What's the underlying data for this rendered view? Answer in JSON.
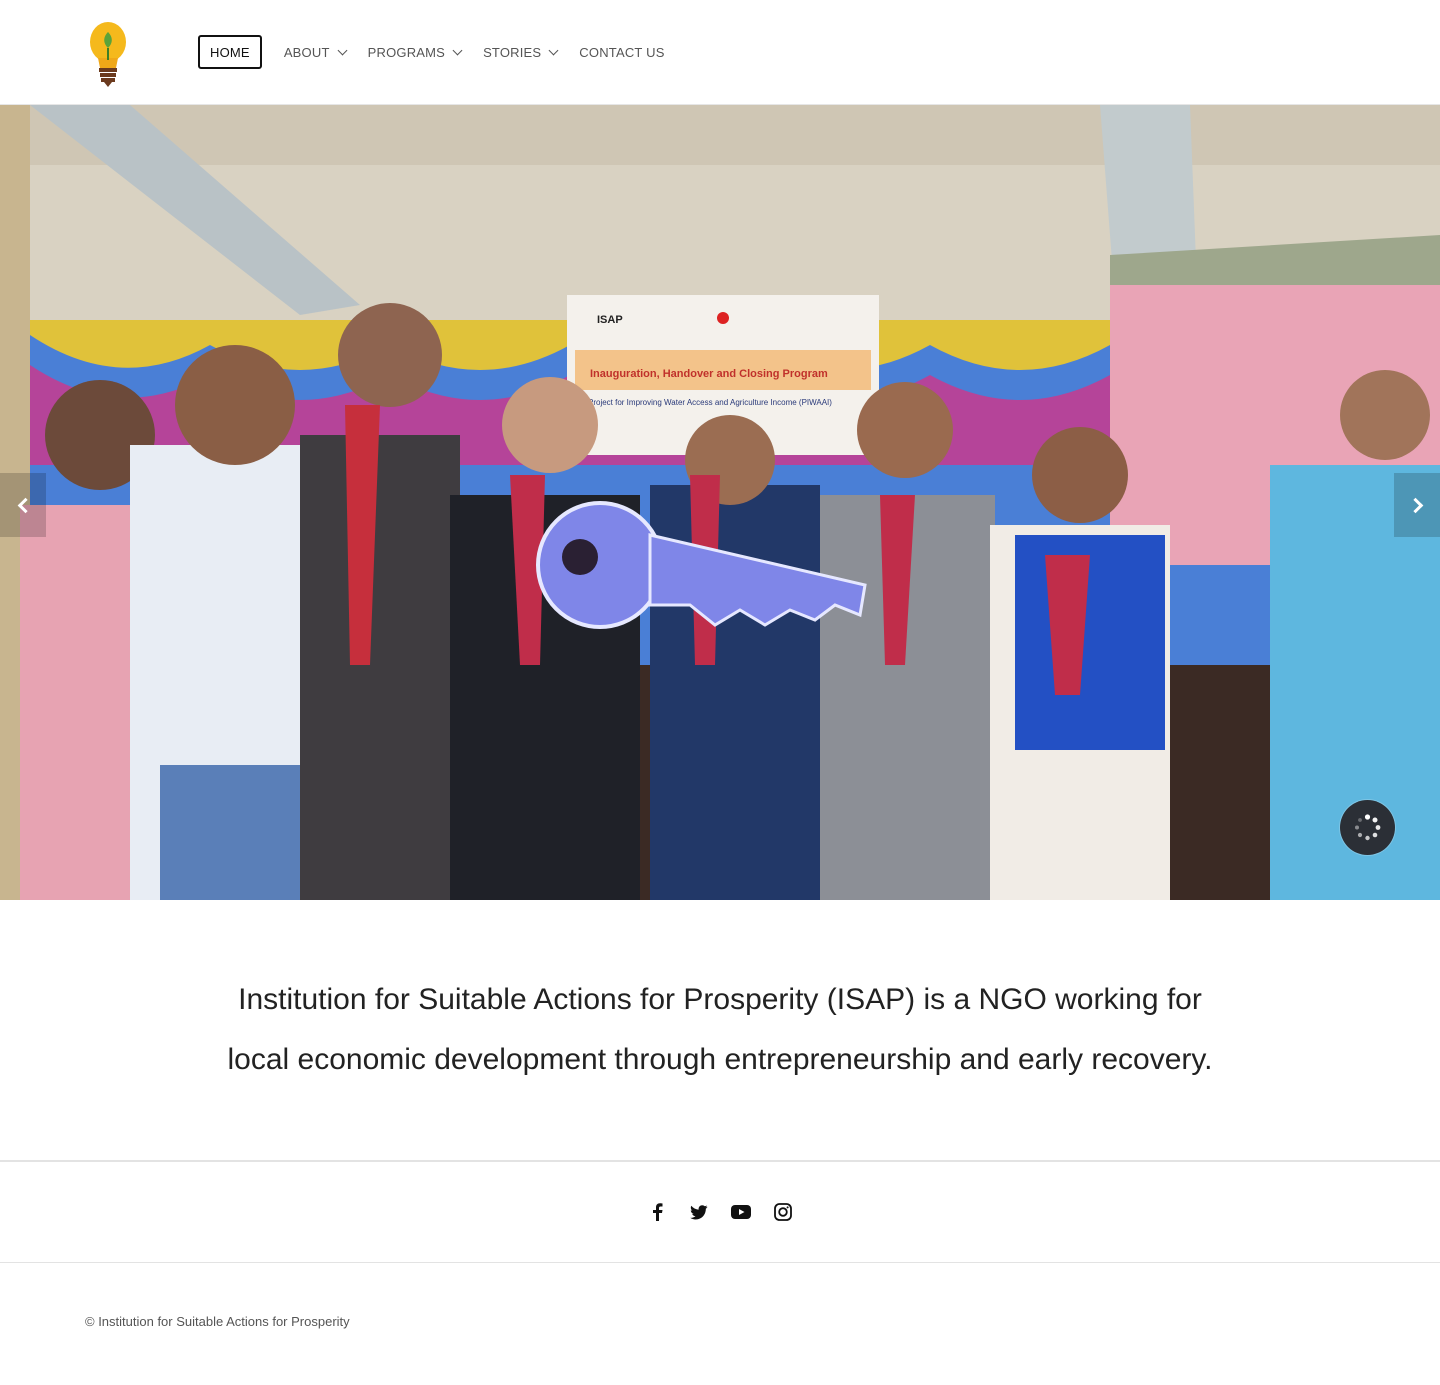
{
  "nav": {
    "items": [
      {
        "label": "HOME",
        "active": true,
        "has_dropdown": false
      },
      {
        "label": "ABOUT",
        "active": false,
        "has_dropdown": true
      },
      {
        "label": "PROGRAMS",
        "active": false,
        "has_dropdown": true
      },
      {
        "label": "STORIES",
        "active": false,
        "has_dropdown": true
      },
      {
        "label": "CONTACT US",
        "active": false,
        "has_dropdown": false
      }
    ]
  },
  "hero": {
    "banner_lines": {
      "org": "ISAP",
      "program": "Inauguration, Handover and Closing Program",
      "project": "Project for Improving Water Access and Agriculture Income (PIWAAI)"
    }
  },
  "mission": {
    "text": "Institution for Suitable Actions for Prosperity (ISAP) is a NGO working for local economic development through entrepreneurship and early recovery."
  },
  "social": {
    "icons": [
      "facebook-icon",
      "twitter-icon",
      "youtube-icon",
      "instagram-icon"
    ]
  },
  "footer": {
    "copyright": "© Institution for Suitable Actions for Prosperity"
  },
  "colors": {
    "nav_text": "#555555",
    "active_border": "#111111",
    "spinner_bg": "#2b2f36",
    "separator": "#e3e3e3"
  }
}
